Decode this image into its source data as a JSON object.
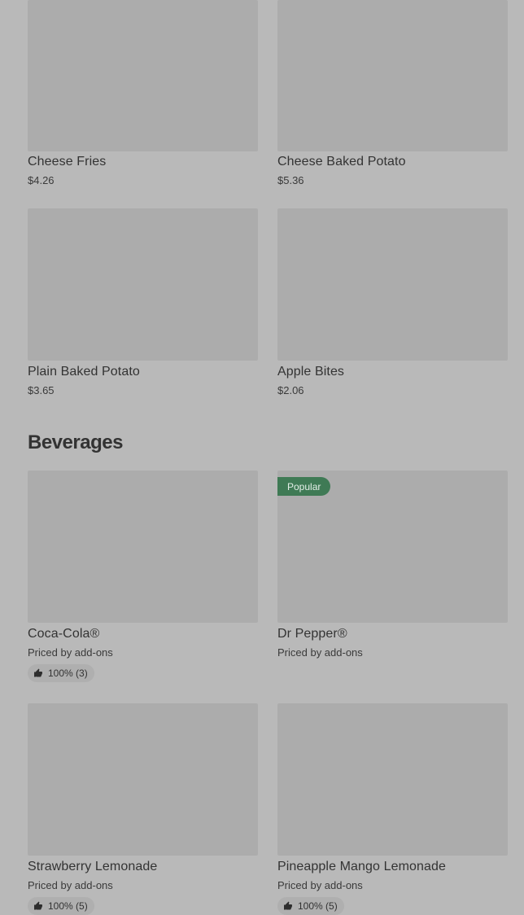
{
  "sections": {
    "beverages_title": "Beverages"
  },
  "items": [
    {
      "name": "Cheese Fries",
      "price": "$4.26"
    },
    {
      "name": "Cheese Baked Potato",
      "price": "$5.36"
    },
    {
      "name": "Plain Baked Potato",
      "price": "$3.65"
    },
    {
      "name": "Apple Bites",
      "price": "$2.06"
    }
  ],
  "beverages": [
    {
      "name": "Coca-Cola®",
      "price": "Priced by add-ons",
      "rating": "100% (3)"
    },
    {
      "name": "Dr Pepper®",
      "price": "Priced by add-ons",
      "badge": "Popular"
    },
    {
      "name": "Strawberry Lemonade",
      "price": "Priced by add-ons",
      "rating": "100% (5)"
    },
    {
      "name": "Pineapple Mango Lemonade",
      "price": "Priced by add-ons",
      "rating": "100% (5)"
    }
  ],
  "colors": {
    "background": "#b9b9b9",
    "thumbnail": "#acacac",
    "popular_badge": "#3f7a55"
  },
  "icons": {
    "rating": "thumbs-up-icon"
  }
}
